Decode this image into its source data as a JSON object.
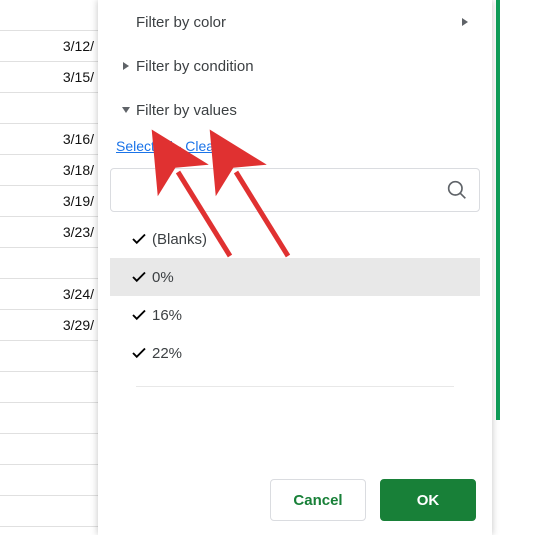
{
  "sheet": {
    "dates": [
      "3/12/",
      "3/15/",
      "3/16/",
      "3/18/",
      "3/19/",
      "3/23/",
      "",
      "3/24/",
      "3/29/"
    ]
  },
  "filter_panel": {
    "by_color_label": "Filter by color",
    "by_condition_label": "Filter by condition",
    "by_values_label": "Filter by values",
    "select_all_label": "Select all",
    "separator": " - ",
    "clear_label": "Clear",
    "search_placeholder": "",
    "values": [
      {
        "label": "(Blanks)",
        "checked": true,
        "selected": false
      },
      {
        "label": "0%",
        "checked": true,
        "selected": true
      },
      {
        "label": "16%",
        "checked": true,
        "selected": false
      },
      {
        "label": "22%",
        "checked": true,
        "selected": false
      }
    ],
    "cancel_label": "Cancel",
    "ok_label": "OK"
  }
}
